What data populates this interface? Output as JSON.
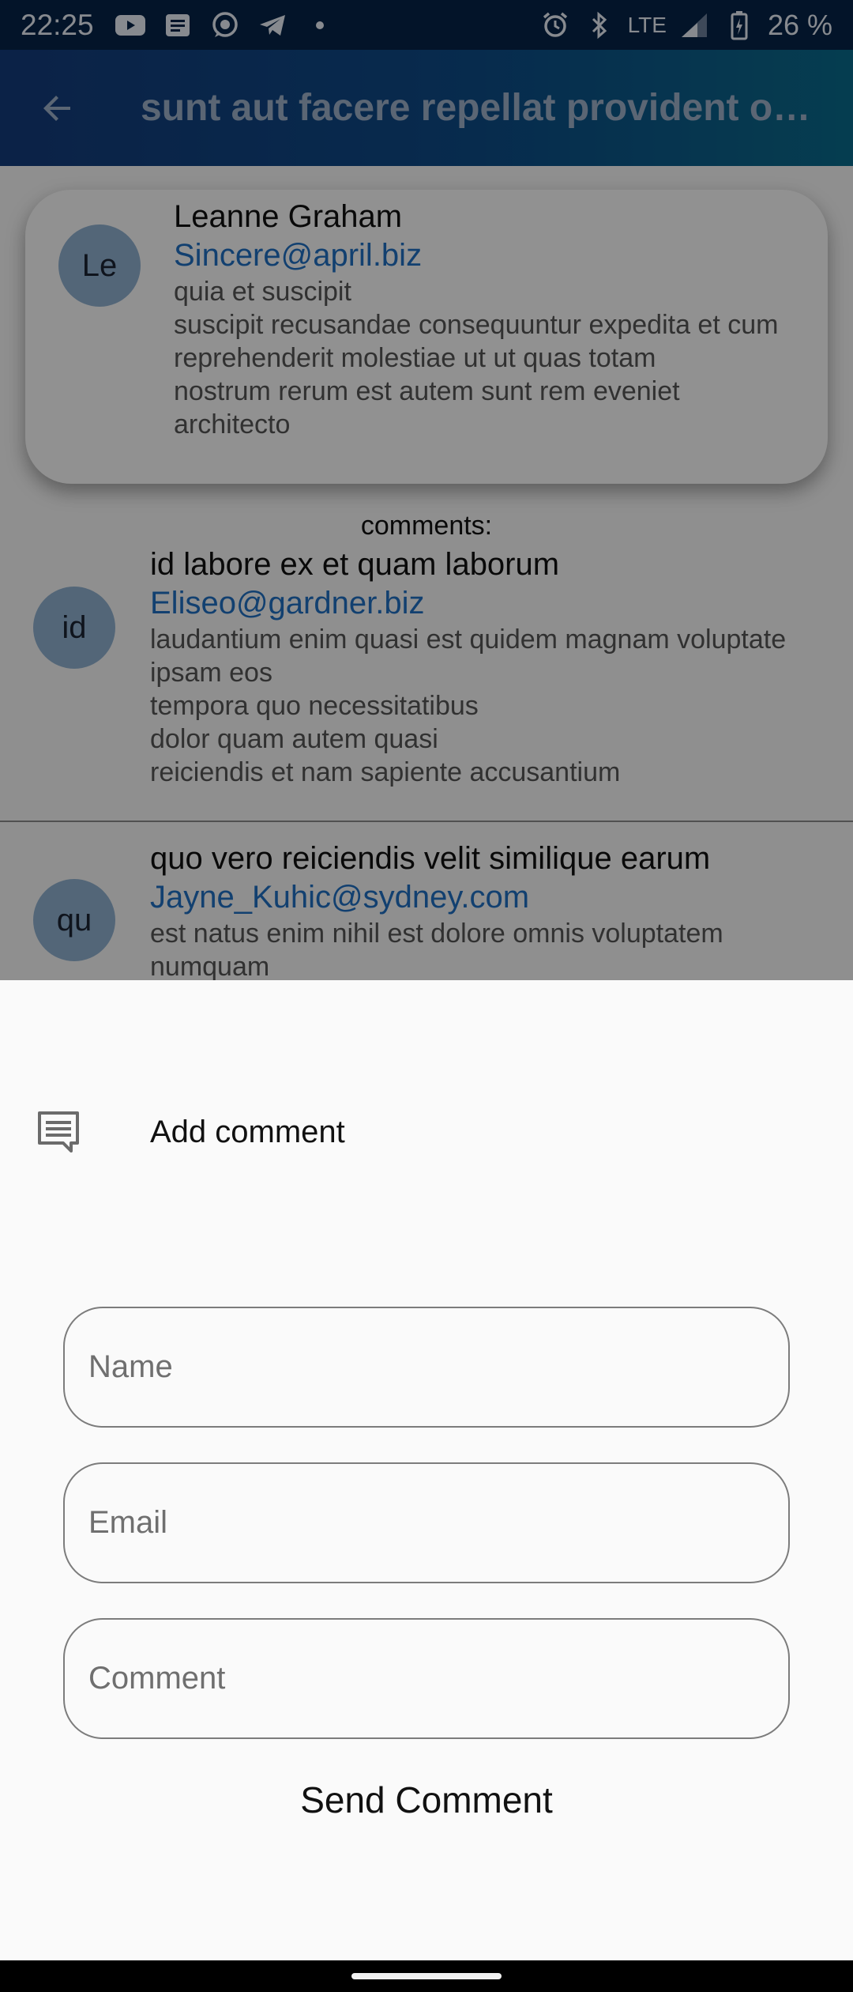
{
  "status_bar": {
    "time": "22:25",
    "network": "LTE",
    "battery": "26 %",
    "icons": [
      "youtube-icon",
      "message-icon",
      "whatsapp-icon",
      "telegram-icon",
      "dot-icon",
      "alarm-icon",
      "bluetooth-icon",
      "signal-icon",
      "battery-icon"
    ]
  },
  "app_bar": {
    "title": "sunt aut facere repellat provident occaecati excepturi optio reprehenderit",
    "back_icon": "arrow-back-icon"
  },
  "post": {
    "avatar_initials": "Le",
    "author_name": "Leanne Graham",
    "author_email": "Sincere@april.biz",
    "body_lines": [
      "quia et suscipit",
      "suscipit recusandae consequuntur expedita et cum",
      "reprehenderit molestiae ut ut quas totam",
      "nostrum rerum est autem sunt rem eveniet architecto"
    ]
  },
  "comments_label": "comments:",
  "comments": [
    {
      "avatar_initials": "id",
      "title": "id labore ex et quam laborum",
      "email": "Eliseo@gardner.biz",
      "body_lines": [
        "laudantium enim quasi est quidem magnam voluptate ipsam eos",
        "tempora quo necessitatibus",
        "dolor quam autem quasi",
        "reiciendis et nam sapiente accusantium"
      ]
    },
    {
      "avatar_initials": "qu",
      "title": "quo vero reiciendis velit similique earum",
      "email": "Jayne_Kuhic@sydney.com",
      "body_lines": [
        "est natus enim nihil est dolore omnis voluptatem numquam"
      ]
    }
  ],
  "sheet": {
    "icon": "comment-icon",
    "title": "Add comment",
    "name_placeholder": "Name",
    "email_placeholder": "Email",
    "comment_placeholder": "Comment",
    "send_label": "Send Comment"
  }
}
